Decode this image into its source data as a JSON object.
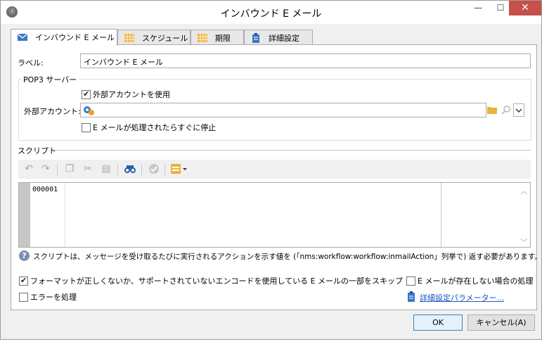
{
  "window": {
    "title": "インバウンド E メール",
    "app_icon": "ⓓ",
    "minimize_glyph": "—",
    "maximize_glyph": "☐",
    "close_glyph": "✕"
  },
  "tabs": [
    {
      "label": "インバウンド E メール",
      "icon": "envelope-icon",
      "active": true
    },
    {
      "label": "スケジュール",
      "icon": "calendar-icon",
      "active": false
    },
    {
      "label": "期限",
      "icon": "calendar-icon",
      "active": false
    },
    {
      "label": "詳細設定",
      "icon": "clipboard-icon",
      "active": false
    }
  ],
  "general": {
    "label_caption": "ラベル:",
    "label_value": "インバウンド E メール"
  },
  "pop3": {
    "group_title": "POP3 サーバー",
    "use_external_account": {
      "label": "外部アカウントを使用",
      "checked": true
    },
    "external_account_caption": "外部アカウント:",
    "external_account_value": "",
    "stop_after_processing": {
      "label": "E メールが処理されたらすぐに停止",
      "checked": false
    }
  },
  "script": {
    "section_title": "スクリプト",
    "toolbar": [
      "undo-icon",
      "redo-icon",
      "copy-icon",
      "cut-icon",
      "paste-icon",
      "find-icon",
      "validate-icon",
      "insert-menu-icon"
    ],
    "line_number": "000001",
    "help_text": "スクリプトは、メッセージを受け取るたびに実行されるアクションを示す値を (「nms:workflow:workflow:inmailAction」列挙で) 返す必要があります。"
  },
  "options": {
    "skip_bad_format": {
      "label": "フォーマットが正しくないか、サポートされていないエンコードを使用している E メールの一部をスキップ",
      "checked": true
    },
    "handle_no_email": {
      "label": "E メールが存在しない場合の処理",
      "checked": false
    },
    "handle_errors": {
      "label": "エラーを処理",
      "checked": false
    },
    "advanced_params_link": "詳細設定パラメーター..."
  },
  "buttons": {
    "ok": "OK",
    "cancel": "キャンセル(A)"
  },
  "colors": {
    "accent": "#3c7fb1",
    "close_button": "#c7504a",
    "link": "#1a56c8",
    "tab_icon_orange": "#f3b43a",
    "tab_icon_blue": "#3a78c8"
  }
}
